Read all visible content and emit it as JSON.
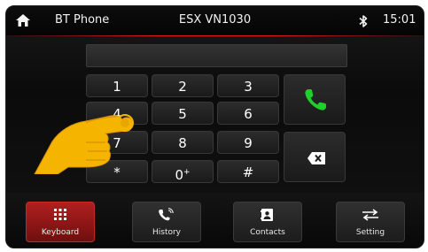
{
  "topbar": {
    "home_icon": "home-icon",
    "app_title": "BT Phone",
    "device_name": "ESX VN1030",
    "bluetooth_icon": "bluetooth-icon",
    "time": "15:01"
  },
  "dialer": {
    "display_value": "",
    "keys": [
      "1",
      "2",
      "3",
      "4",
      "5",
      "6",
      "7",
      "8",
      "9",
      "*",
      "0",
      "#"
    ],
    "zero_sup": "+",
    "call_icon": "phone-call-icon",
    "call_color": "#1fcf2a",
    "delete_icon": "backspace-icon"
  },
  "overlay": {
    "hand_icon": "pointing-hand-icon",
    "hand_color": "#f5b400"
  },
  "bottom_tabs": [
    {
      "label": "Keyboard",
      "icon": "keypad-icon",
      "active": true
    },
    {
      "label": "History",
      "icon": "call-history-icon",
      "active": false
    },
    {
      "label": "Contacts",
      "icon": "contacts-icon",
      "active": false
    },
    {
      "label": "Setting",
      "icon": "settings-arrows-icon",
      "active": false
    }
  ],
  "colors": {
    "accent_red": "#e01818",
    "active_tab": "#b21f1f",
    "background": "#0b0b0b"
  }
}
